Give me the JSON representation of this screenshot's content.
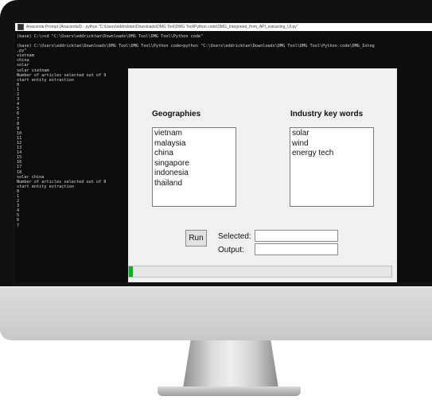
{
  "window": {
    "title": "Anaconda Prompt (Anaconda3) - python \"C:\\Users\\eddricktan\\Downloads\\DMG Tool\\DMG Tool\\Python code\\DMG_Integrated_from_API_extracting_UI.py\""
  },
  "console": {
    "lines_top": [
      "(base) C:\\>cd \"C:\\Users\\eddricktan\\Downloads\\DMG Tool\\DMG Tool\\Python code\"",
      "",
      "(base) C:\\Users\\eddricktan\\Downloads\\DMG Tool\\DMG Tool\\Python code>python \"C:\\Users\\eddricktan\\Downloads\\DMG Tool\\DMG Tool\\Python code\\DMG_Integ",
      ".py\"",
      "vietnam",
      "china",
      "solar",
      "solar vietnam",
      "Number of articles selected out of 9",
      "start entity extraction",
      "0",
      "1",
      "2",
      "3",
      "4",
      "5",
      "6",
      "7",
      "8",
      "9",
      "10",
      "11",
      "12",
      "13",
      "14",
      "15",
      "16",
      "17",
      "18",
      "solar china",
      "Number of articles selected out of 8",
      "start entity extraction",
      "0",
      "1",
      "2",
      "3",
      "4",
      "5",
      "6",
      "7"
    ]
  },
  "dialog": {
    "geographies_label": "Geographies",
    "industry_label": "Industry key words",
    "geographies": [
      "vietnam",
      "malaysia",
      "china",
      "singapore",
      "indonesia",
      "thailand"
    ],
    "industry_keywords": [
      "solar",
      "wind",
      "energy tech"
    ],
    "run_label": "Run",
    "selected_label": "Selected:",
    "output_label": "Output:",
    "selected_value": "",
    "output_value": "",
    "progress_fraction": 0.015,
    "progress_color": "#06b025"
  }
}
